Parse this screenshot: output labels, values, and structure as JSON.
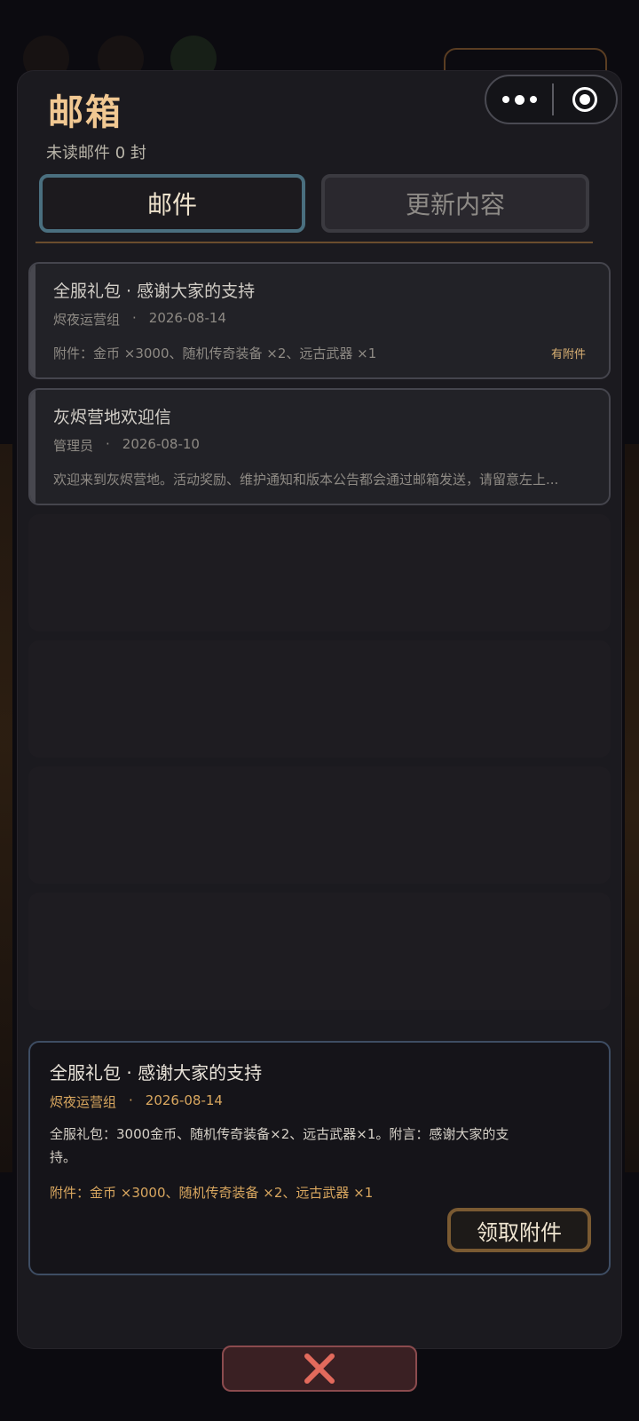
{
  "mailbox": {
    "title": "邮箱",
    "unread_text": "未读邮件 0 封",
    "tabs": [
      {
        "label": "邮件",
        "active": true
      },
      {
        "label": "更新内容",
        "active": false
      }
    ]
  },
  "capsule": {
    "more_icon": "more-dots-icon",
    "close_icon": "target-circle-icon"
  },
  "mails": [
    {
      "title": "全服礼包 · 感谢大家的支持",
      "sender": "烬夜运营组",
      "dot": "·",
      "date": "2026-08-14",
      "preview": "附件：金币 ×3000、随机传奇装备 ×2、远古武器 ×1",
      "badge": "有附件"
    },
    {
      "title": "灰烬营地欢迎信",
      "sender": "管理员",
      "dot": "·",
      "date": "2026-08-10",
      "preview": "欢迎来到灰烬营地。活动奖励、维护通知和版本公告都会通过邮箱发送，请留意左上...",
      "badge": ""
    }
  ],
  "detail": {
    "title": "全服礼包 · 感谢大家的支持",
    "sender": "烬夜运营组",
    "dot": "·",
    "date": "2026-08-14",
    "body": "全服礼包：3000金币、随机传奇装备×2、远古武器×1。附言：感谢大家的支持。",
    "attachments": "附件：金币 ×3000、随机传奇装备 ×2、远古武器 ×1",
    "claim_label": "领取附件"
  },
  "close_button": {
    "icon": "close-x-icon"
  },
  "colors": {
    "accent_gold": "#f1c892",
    "active_tab_border": "#4a6f7f",
    "close_red": "#e26a5c"
  }
}
